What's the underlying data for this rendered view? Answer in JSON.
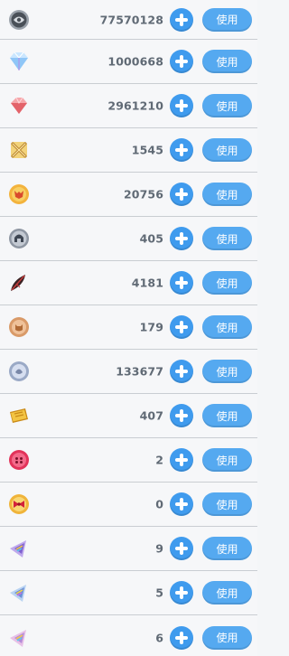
{
  "items": [
    {
      "icon": "silver-coin-icon",
      "count": "77570128",
      "use_label": "使用"
    },
    {
      "icon": "diamond-gem-icon",
      "count": "1000668",
      "use_label": "使用"
    },
    {
      "icon": "red-crystal-icon",
      "count": "2961210",
      "use_label": "使用"
    },
    {
      "icon": "crossed-swords-icon",
      "count": "1545",
      "use_label": "使用"
    },
    {
      "icon": "fox-medal-icon",
      "count": "20756",
      "use_label": "使用"
    },
    {
      "icon": "helmet-medal-icon",
      "count": "405",
      "use_label": "使用"
    },
    {
      "icon": "dark-feather-icon",
      "count": "4181",
      "use_label": "使用"
    },
    {
      "icon": "bronze-cat-medal-icon",
      "count": "179",
      "use_label": "使用"
    },
    {
      "icon": "silver-medal-icon",
      "count": "133677",
      "use_label": "使用"
    },
    {
      "icon": "gold-ticket-icon",
      "count": "407",
      "use_label": "使用"
    },
    {
      "icon": "pink-button-icon",
      "count": "2",
      "use_label": "使用"
    },
    {
      "icon": "ribbon-medal-icon",
      "count": "0",
      "use_label": "使用"
    },
    {
      "icon": "rainbow-prism-icon",
      "count": "9",
      "use_label": "使用"
    },
    {
      "icon": "blue-prism-icon",
      "count": "5",
      "use_label": "使用"
    },
    {
      "icon": "pink-prism-icon",
      "count": "6",
      "use_label": "使用"
    }
  ]
}
